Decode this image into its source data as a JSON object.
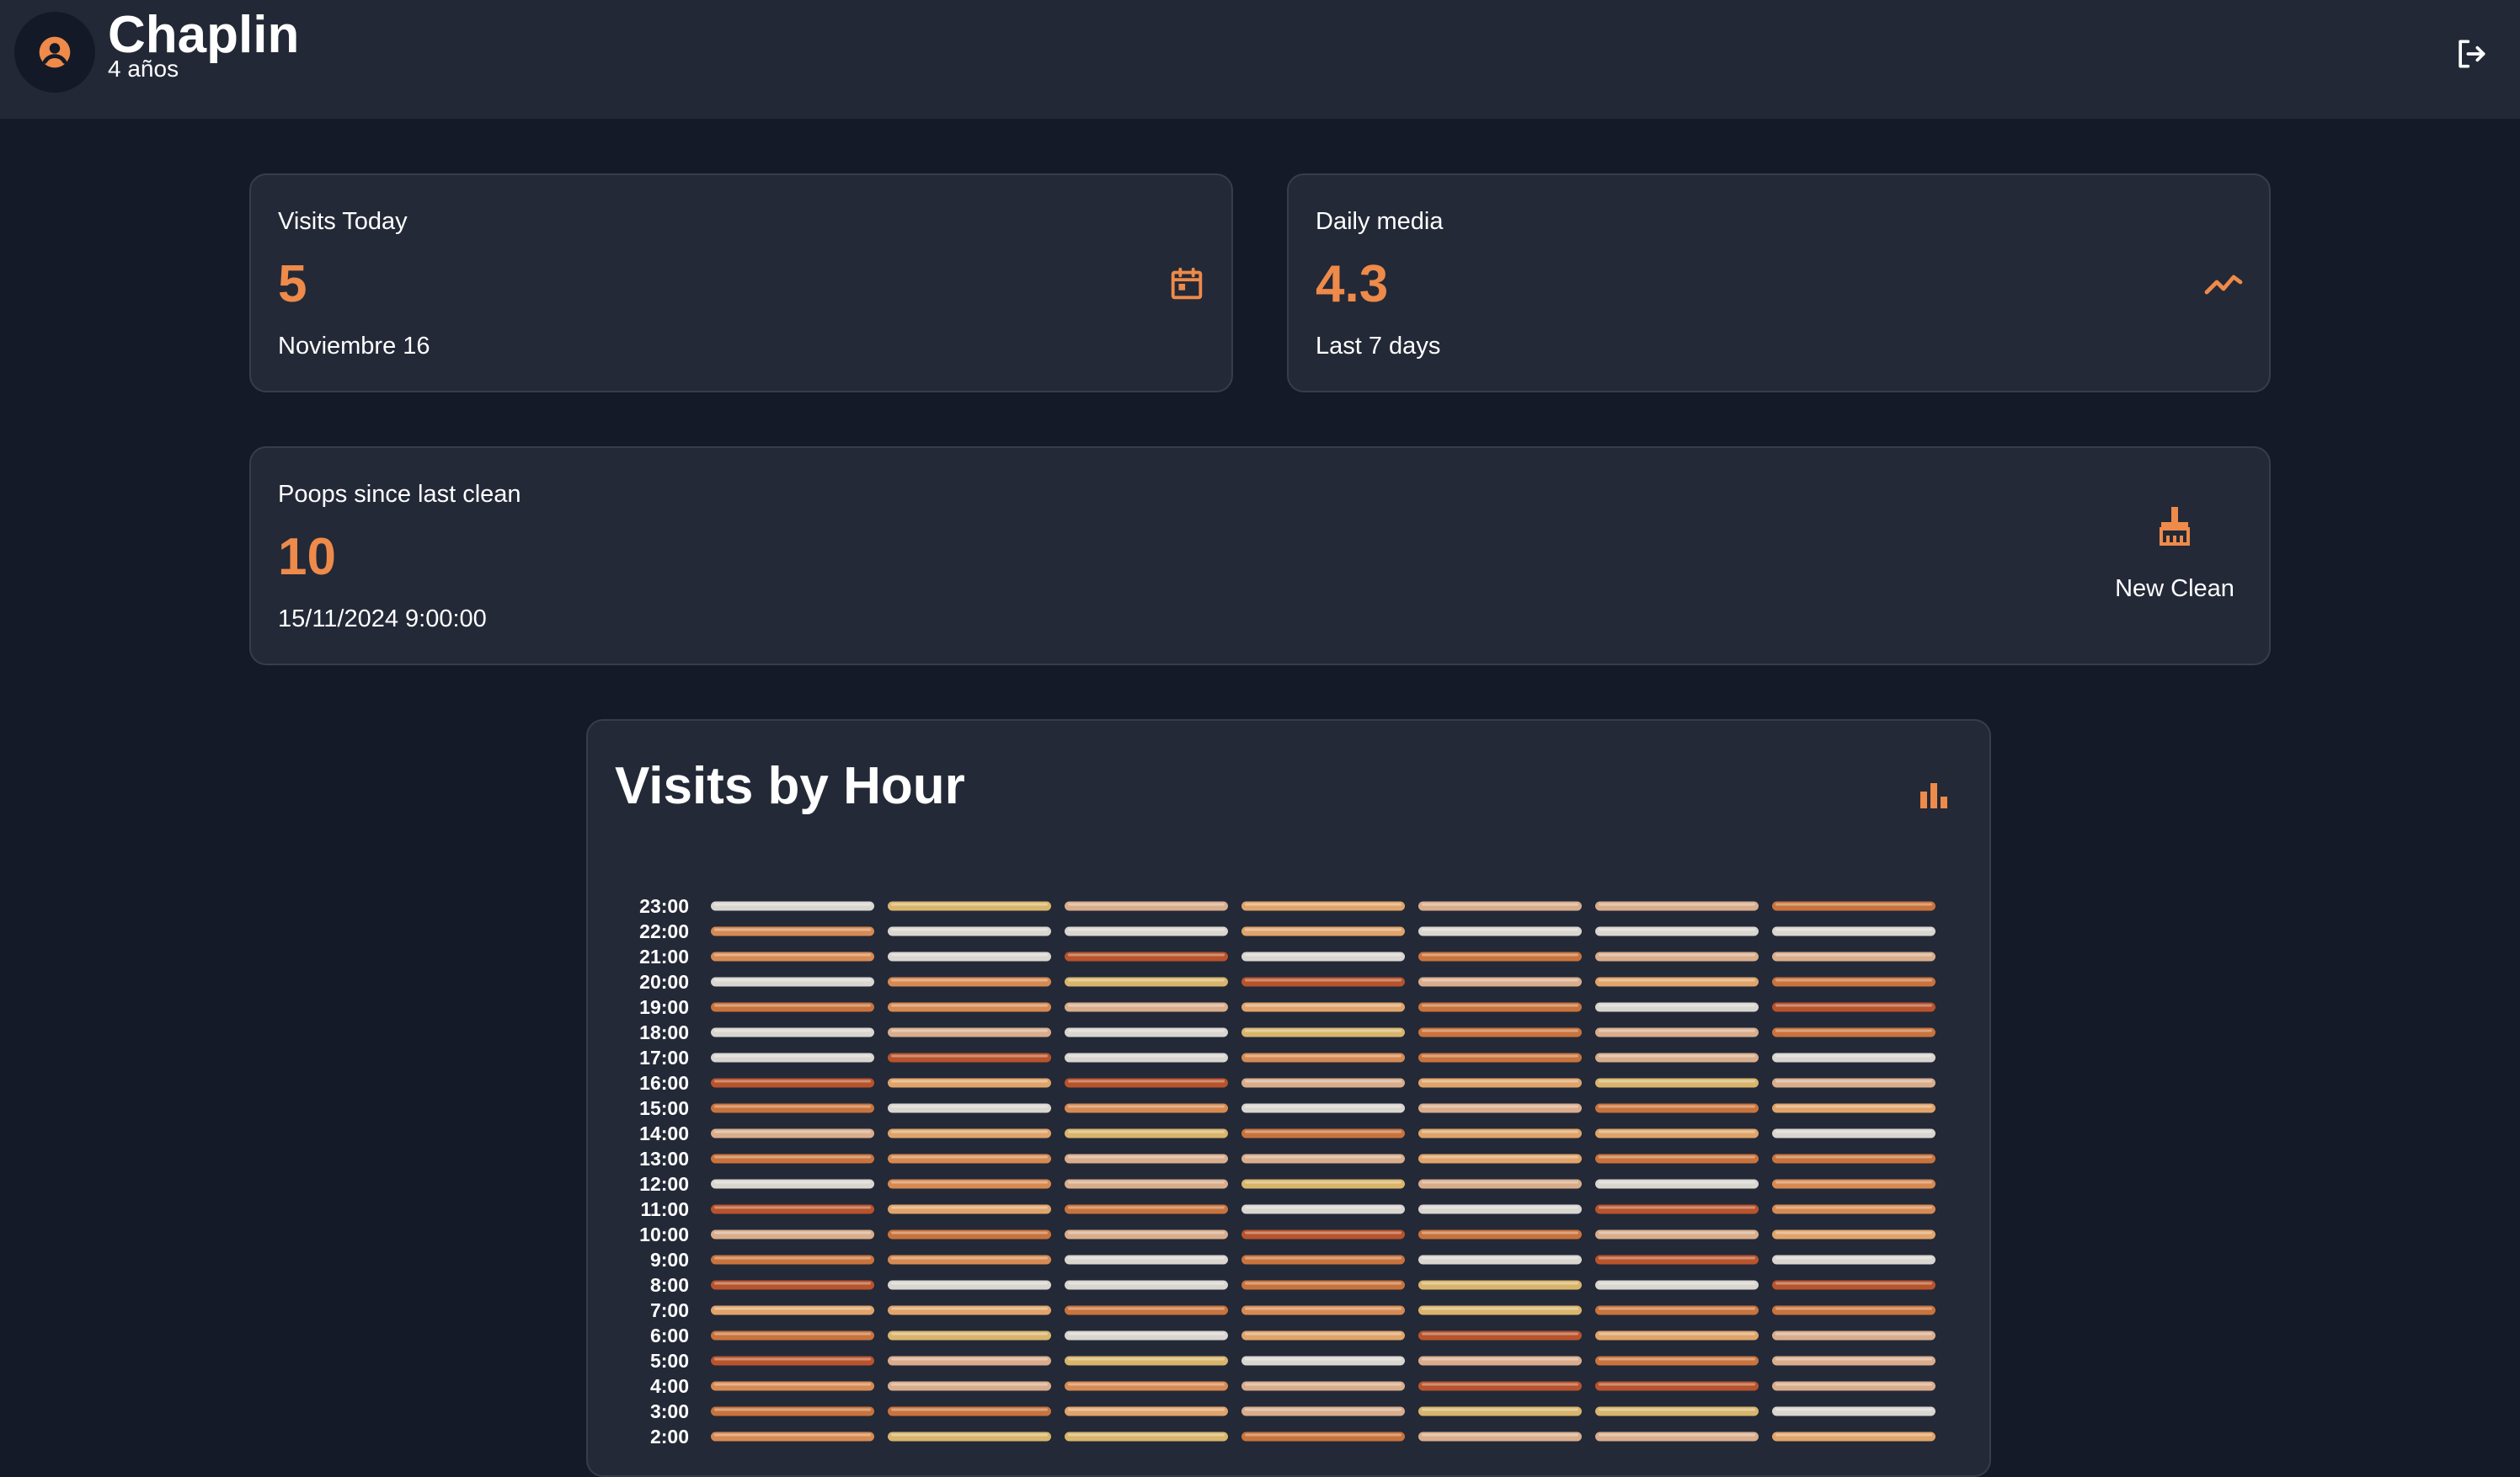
{
  "header": {
    "pet_name": "Chaplin",
    "pet_age": "4 años",
    "avatar_icon": "user-circle-icon",
    "logout_icon": "logout-icon"
  },
  "cards": {
    "visits_today": {
      "label": "Visits Today",
      "value": "5",
      "subtitle": "Noviembre 16",
      "icon": "calendar-icon"
    },
    "daily_media": {
      "label": "Daily media",
      "value": "4.3",
      "subtitle": "Last 7 days",
      "icon": "trend-line-icon"
    },
    "poops": {
      "label": "Poops since last clean",
      "value": "10",
      "subtitle": "15/11/2024 9:00:00",
      "button_label": "New Clean",
      "button_icon": "broom-icon"
    }
  },
  "colors": {
    "accent": "#ee8a4a",
    "background": "#141a27",
    "card": "#232937",
    "card_border": "#373d4b"
  },
  "chart_data": {
    "type": "heatmap",
    "title": "Visits by Hour",
    "icon": "bar-chart-icon",
    "y_categories": [
      "23:00",
      "22:00",
      "21:00",
      "20:00",
      "19:00",
      "18:00",
      "17:00",
      "16:00",
      "15:00",
      "14:00",
      "13:00",
      "12:00",
      "11:00",
      "10:00",
      "9:00",
      "8:00",
      "7:00",
      "6:00",
      "5:00",
      "4:00",
      "3:00",
      "2:00"
    ],
    "columns": 7,
    "palette": [
      "#d9d5cf",
      "#d9ad8c",
      "#e0a46a",
      "#d68a52",
      "#c9733c",
      "#b8532c",
      "#d9b56c"
    ],
    "cells": [
      [
        0,
        6,
        1,
        2,
        1,
        1,
        4
      ],
      [
        3,
        0,
        0,
        2,
        0,
        0,
        0
      ],
      [
        3,
        0,
        5,
        0,
        4,
        1,
        1
      ],
      [
        0,
        3,
        6,
        5,
        1,
        2,
        4
      ],
      [
        4,
        3,
        1,
        2,
        4,
        0,
        5
      ],
      [
        0,
        1,
        0,
        6,
        4,
        1,
        4
      ],
      [
        0,
        5,
        0,
        3,
        4,
        1,
        0
      ],
      [
        5,
        2,
        5,
        1,
        2,
        6,
        1
      ],
      [
        4,
        0,
        3,
        0,
        1,
        4,
        2
      ],
      [
        1,
        2,
        6,
        4,
        2,
        2,
        0
      ],
      [
        4,
        3,
        1,
        1,
        2,
        4,
        4
      ],
      [
        0,
        3,
        1,
        6,
        1,
        0,
        3
      ],
      [
        5,
        2,
        4,
        0,
        0,
        5,
        3
      ],
      [
        1,
        4,
        1,
        5,
        4,
        1,
        2
      ],
      [
        4,
        3,
        0,
        4,
        0,
        5,
        0
      ],
      [
        5,
        0,
        0,
        4,
        6,
        0,
        5
      ],
      [
        2,
        2,
        4,
        3,
        6,
        4,
        4
      ],
      [
        4,
        6,
        0,
        2,
        5,
        2,
        1
      ],
      [
        5,
        1,
        6,
        0,
        1,
        4,
        1
      ],
      [
        3,
        1,
        3,
        1,
        5,
        5,
        1
      ],
      [
        4,
        4,
        2,
        1,
        6,
        6,
        0
      ],
      [
        3,
        6,
        6,
        4,
        1,
        1,
        2
      ]
    ]
  }
}
